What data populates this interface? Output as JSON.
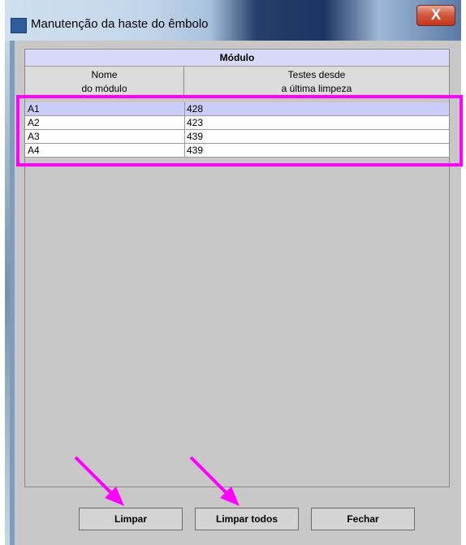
{
  "window": {
    "title": "Manutenção da haste do êmbolo",
    "close_label": "X"
  },
  "table": {
    "header": "Módulo",
    "columns": [
      {
        "line1": "Nome",
        "line2": "do módulo"
      },
      {
        "line1": "Testes desde",
        "line2": "a última limpeza"
      }
    ],
    "rows": [
      {
        "name": "A1",
        "tests": "428",
        "selected": true
      },
      {
        "name": "A2",
        "tests": "423",
        "selected": false
      },
      {
        "name": "A3",
        "tests": "439",
        "selected": false
      },
      {
        "name": "A4",
        "tests": "439",
        "selected": false
      }
    ]
  },
  "buttons": {
    "limpar": "Limpar",
    "limpar_todos": "Limpar todos",
    "fechar": "Fechar"
  },
  "annotations": {
    "highlight_color": "#ff00ff",
    "arrow_color": "#ff00ff"
  }
}
